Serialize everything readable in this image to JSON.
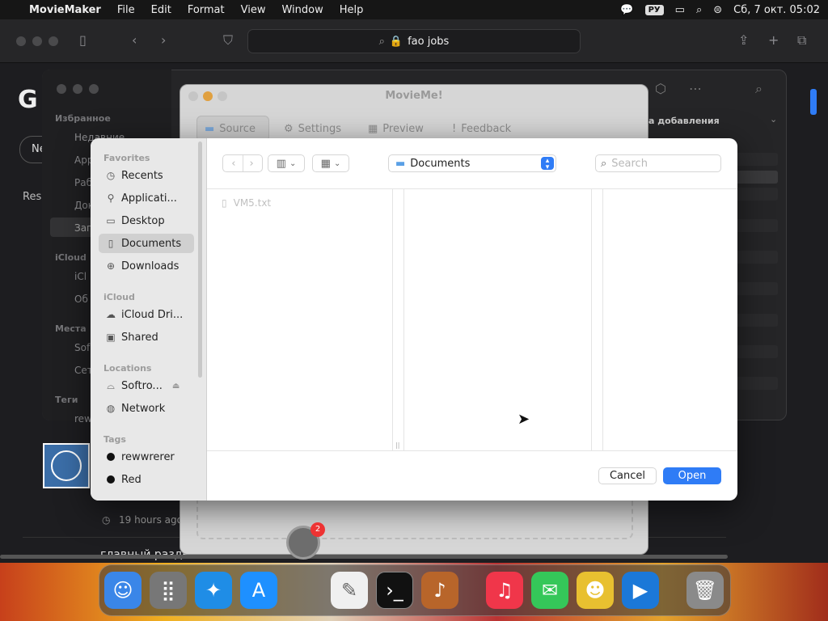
{
  "menubar": {
    "app": "MovieMaker",
    "items": [
      "File",
      "Edit",
      "Format",
      "View",
      "Window",
      "Help"
    ],
    "lang": "РУ",
    "clock": "Сб, 7 окт.  05:02"
  },
  "safari": {
    "url": "fao jobs"
  },
  "webpage": {
    "logo_partial": "G",
    "result_partial": "Res",
    "timestamp": "19 hours ago",
    "heading": "главный раздел",
    "new_partial": "Ne"
  },
  "finder_bg": {
    "favorites_head": "Избранное",
    "items": [
      "Недавние",
      "Арр",
      "Раб",
      "Док",
      "Заг"
    ],
    "icloud_head": "iCloud",
    "icloud_items": [
      "iCl",
      "Об"
    ],
    "places_head": "Места",
    "places_items": [
      "Sof",
      "Сет"
    ],
    "tags_head": "Теги",
    "tags_items": [
      "rew"
    ],
    "sort_label": "а добавления"
  },
  "movieme": {
    "title": "MovieMe!",
    "tabs": [
      "Source",
      "Settings",
      "Preview",
      "Feedback"
    ]
  },
  "dialog": {
    "sidebar": {
      "favorites_head": "Favorites",
      "favorites": [
        "Recents",
        "Applicati...",
        "Desktop",
        "Documents",
        "Downloads"
      ],
      "icloud_head": "iCloud",
      "icloud": [
        "iCloud Dri...",
        "Shared"
      ],
      "locations_head": "Locations",
      "locations": [
        "Softro...",
        "Network"
      ],
      "tags_head": "Tags",
      "tags": [
        "rewwrerer",
        "Red"
      ]
    },
    "path": "Documents",
    "search_placeholder": "Search",
    "files": [
      "VM5.txt"
    ],
    "cancel": "Cancel",
    "open": "Open"
  },
  "dock": {
    "badge": "2"
  },
  "colors": {
    "accent": "#2f7cf6",
    "dock_bg": "#3c3c3c"
  }
}
